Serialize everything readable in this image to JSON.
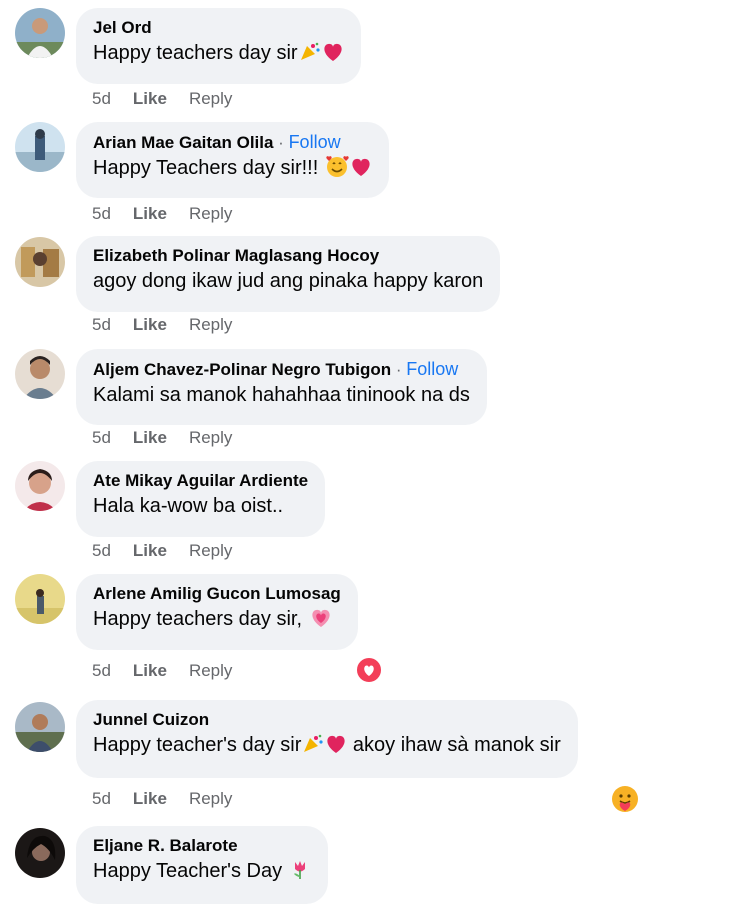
{
  "comments": [
    {
      "name": "Jel Ord",
      "follow": "",
      "text": "Happy teachers day sir",
      "emoji": [
        "party-popper",
        "red-heart"
      ],
      "time": "5d",
      "like": "Like",
      "reply": "Reply",
      "reaction": ""
    },
    {
      "name": "Arian Mae Gaitan Olila",
      "follow": "Follow",
      "text": "Happy Teachers day sir!!! ",
      "emoji": [
        "smiling-face-with-hearts",
        "red-heart"
      ],
      "time": "5d",
      "like": "Like",
      "reply": "Reply",
      "reaction": ""
    },
    {
      "name": "Elizabeth Polinar Maglasang Hocoy",
      "follow": "",
      "text": "agoy dong ikaw jud ang pinaka happy karon",
      "emoji": [],
      "time": "5d",
      "like": "Like",
      "reply": "Reply",
      "reaction": ""
    },
    {
      "name": "Aljem Chavez-Polinar Negro Tubigon",
      "follow": "Follow",
      "text": "Kalami sa manok hahahhaa tininook na ds",
      "emoji": [],
      "time": "5d",
      "like": "Like",
      "reply": "Reply",
      "reaction": ""
    },
    {
      "name": "Ate Mikay Aguilar Ardiente",
      "follow": "",
      "text": "Hala ka-wow ba oist..",
      "emoji": [],
      "time": "5d",
      "like": "Like",
      "reply": "Reply",
      "reaction": ""
    },
    {
      "name": "Arlene Amilig Gucon Lumosag",
      "follow": "",
      "text": "Happy teachers day sir, ",
      "emoji": [
        "growing-heart"
      ],
      "time": "5d",
      "like": "Like",
      "reply": "Reply",
      "reaction": "love"
    },
    {
      "name": "Junnel Cuizon",
      "follow": "",
      "text": "Happy teacher's day sir",
      "emoji": [
        "party-popper",
        "red-heart"
      ],
      "text2": " akoy ihaw sà manok sir",
      "time": "5d",
      "like": "Like",
      "reply": "Reply",
      "reaction": "care"
    },
    {
      "name": "Eljane R. Balarote",
      "follow": "",
      "text": "Happy Teacher's Day ",
      "emoji": [
        "tulip"
      ],
      "time": "",
      "like": "",
      "reply": "",
      "reaction": ""
    }
  ],
  "follow_separator": " · ",
  "colors": {
    "bubble": "#f0f2f5",
    "follow": "#1877f2",
    "meta": "#65676b",
    "text": "#050505"
  }
}
